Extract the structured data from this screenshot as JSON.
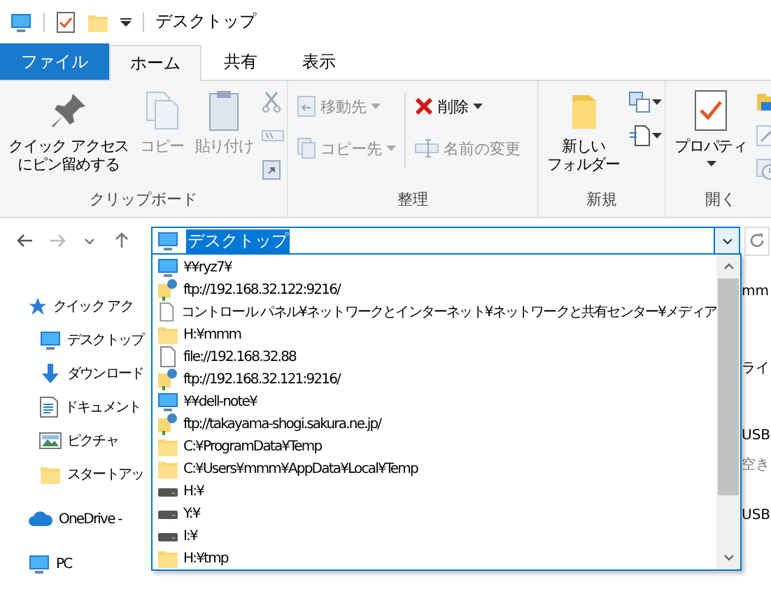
{
  "title_bar": {
    "title": "デスクトップ"
  },
  "ribbon_tabs": [
    {
      "label": "ファイル",
      "kind": "file",
      "selected": false
    },
    {
      "label": "ホーム",
      "kind": "tab",
      "selected": true
    },
    {
      "label": "共有",
      "kind": "tab",
      "selected": false
    },
    {
      "label": "表示",
      "kind": "tab",
      "selected": false
    }
  ],
  "ribbon": {
    "clipboard": {
      "label": "クリップボード",
      "pin": {
        "lines": [
          "クイック アクセス",
          "にピン留めする"
        ],
        "disabled": false
      },
      "copy": {
        "label": "コピー",
        "disabled": true
      },
      "paste": {
        "label": "貼り付け",
        "disabled": true
      }
    },
    "organize": {
      "label": "整理",
      "move_to": {
        "label": "移動先",
        "disabled": true
      },
      "copy_to": {
        "label": "コピー先",
        "disabled": true
      },
      "delete": {
        "label": "削除",
        "disabled": false
      },
      "rename": {
        "label": "名前の変更",
        "disabled": true
      }
    },
    "new": {
      "label": "新規",
      "new_folder": {
        "lines": [
          "新しい",
          "フォルダー"
        ],
        "disabled": false
      }
    },
    "open": {
      "label": "開く",
      "properties": {
        "label": "プロパティ",
        "disabled": false
      }
    }
  },
  "address_bar": {
    "value": "デスクトップ",
    "text_selected": true
  },
  "nav_pane": [
    {
      "label": "クイック アク",
      "kind": "star"
    },
    {
      "label": "デスクトップ",
      "kind": "desktop"
    },
    {
      "label": "ダウンロード",
      "kind": "download"
    },
    {
      "label": "ドキュメント",
      "kind": "document"
    },
    {
      "label": "ピクチャ",
      "kind": "picture"
    },
    {
      "label": "スタートアッ",
      "kind": "folder"
    },
    {
      "label": "OneDrive -",
      "kind": "cloud"
    },
    {
      "label": "PC",
      "kind": "pc"
    }
  ],
  "content_edge": [
    "mm",
    "ライ",
    "USB",
    "空き",
    "USB"
  ],
  "address_history": [
    {
      "text": "¥¥ryz7¥",
      "kind": "computer"
    },
    {
      "text": "ftp://192.168.32.122:9216/",
      "kind": "ftp"
    },
    {
      "text": "コントロール パネル¥ネットワークとインターネット¥ネットワークと共有センター¥メディア",
      "kind": "file"
    },
    {
      "text": "H:¥mmm",
      "kind": "folder"
    },
    {
      "text": "file://192.168.32.88",
      "kind": "file"
    },
    {
      "text": "ftp://192.168.32.121:9216/",
      "kind": "ftp"
    },
    {
      "text": "¥¥dell-note¥",
      "kind": "computer"
    },
    {
      "text": "ftp://takayama-shogi.sakura.ne.jp/",
      "kind": "ftp"
    },
    {
      "text": "C:¥ProgramData¥Temp",
      "kind": "folder"
    },
    {
      "text": "C:¥Users¥mmm¥AppData¥Local¥Temp",
      "kind": "folder"
    },
    {
      "text": "H:¥",
      "kind": "drive"
    },
    {
      "text": "Y:¥",
      "kind": "drive"
    },
    {
      "text": "I:¥",
      "kind": "drive"
    },
    {
      "text": "H:¥tmp",
      "kind": "folder"
    }
  ]
}
